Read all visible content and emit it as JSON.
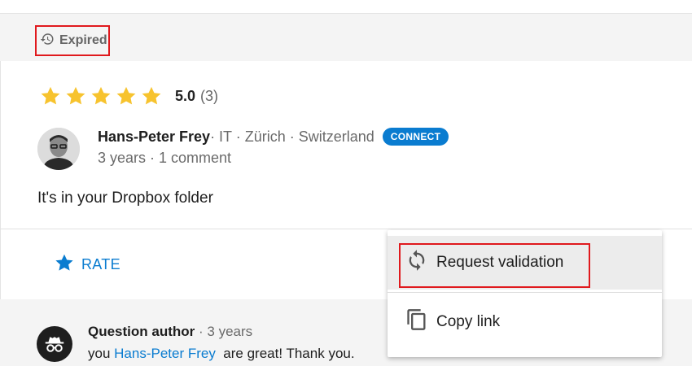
{
  "status": {
    "label": "Expired",
    "icon": "history-icon"
  },
  "rating": {
    "score": "5.0",
    "count": "(3)",
    "stars": 5,
    "star_color": "#f7c32e"
  },
  "author": {
    "name": "Hans-Peter Frey",
    "meta": " · IT · Zürich · Switzerland",
    "connect_label": "CONNECT",
    "sub": "3 years · 1 comment"
  },
  "answer": {
    "text": "It's in your Dropbox folder"
  },
  "actions": {
    "rate_label": "RATE"
  },
  "comment": {
    "author": "Question author",
    "time": " · 3 years",
    "body_prefix": "you ",
    "mention": "Hans-Peter Frey",
    "body_suffix": "  are great! Thank you."
  },
  "menu": {
    "items": [
      {
        "label": "Request validation",
        "icon": "sync-icon"
      },
      {
        "label": "Copy link",
        "icon": "copy-icon"
      }
    ]
  },
  "colors": {
    "accent": "#0a7cd0",
    "highlight": "#e0191d"
  }
}
